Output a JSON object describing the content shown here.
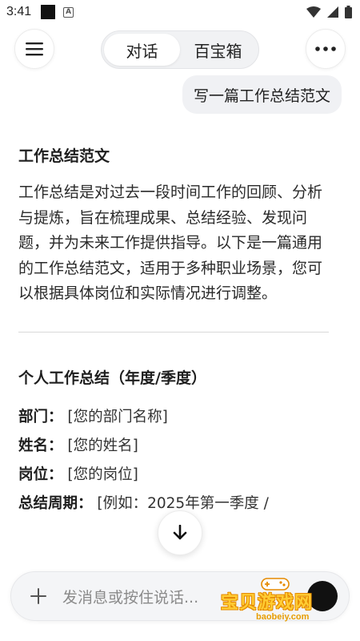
{
  "status_bar": {
    "time": "3:41"
  },
  "header": {
    "tabs": [
      {
        "label": "对话",
        "active": true
      },
      {
        "label": "百宝箱",
        "active": false
      }
    ]
  },
  "user_message": "写一篇工作总结范文",
  "answer": {
    "title": "工作总结范文",
    "intro": "工作总结是对过去一段时间工作的回顾、分析与提炼，旨在梳理成果、总结经验、发现问题，并为未来工作提供指导。以下是一篇通用的工作总结范文，适用于多种职业场景，您可以根据具体岗位和实际情况进行调整。",
    "subtitle": "个人工作总结（年度/季度）",
    "fields": [
      {
        "key": "部门：",
        "value": "[您的部门名称]"
      },
      {
        "key": "姓名：",
        "value": "[您的姓名]"
      },
      {
        "key": "岗位：",
        "value": "[您的岗位]"
      },
      {
        "key": "总结周期：",
        "value": "[例如：2025年第一季度 /"
      }
    ]
  },
  "input": {
    "placeholder": "发消息或按住说话..."
  },
  "watermark": {
    "text": "宝贝游戏网",
    "url": "baobeiy.com"
  },
  "colors": {
    "accent_dark": "#111111",
    "bubble_bg": "#f0f1f4",
    "watermark": "#ffcc33"
  }
}
